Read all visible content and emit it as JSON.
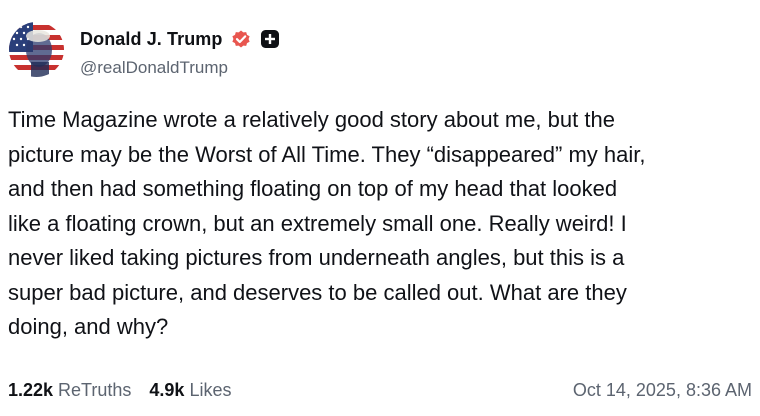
{
  "author": {
    "display_name": "Donald J. Trump",
    "handle": "@realDonaldTrump",
    "avatar_icon": "avatar-flag-portrait",
    "verified_icon": "verified-badge-icon",
    "verified_color": "#e8564f",
    "badge_icon": "plus-badge-icon"
  },
  "post": {
    "lines": [
      "Time Magazine wrote a relatively good story about me, but the",
      "picture may be the Worst of All Time. They “disappeared” my hair,",
      "and then had something floating on top of my head that looked",
      "like a floating crown, but an extremely small one. Really weird! I",
      "never liked taking pictures from underneath angles, but this is a",
      "super bad picture, and deserves to be called out. What are they",
      "doing, and why?"
    ]
  },
  "stats": {
    "retruths_count": "1.22k",
    "retruths_label": "ReTruths",
    "likes_count": "4.9k",
    "likes_label": "Likes"
  },
  "timestamp": "Oct 14, 2025, 8:36 AM"
}
